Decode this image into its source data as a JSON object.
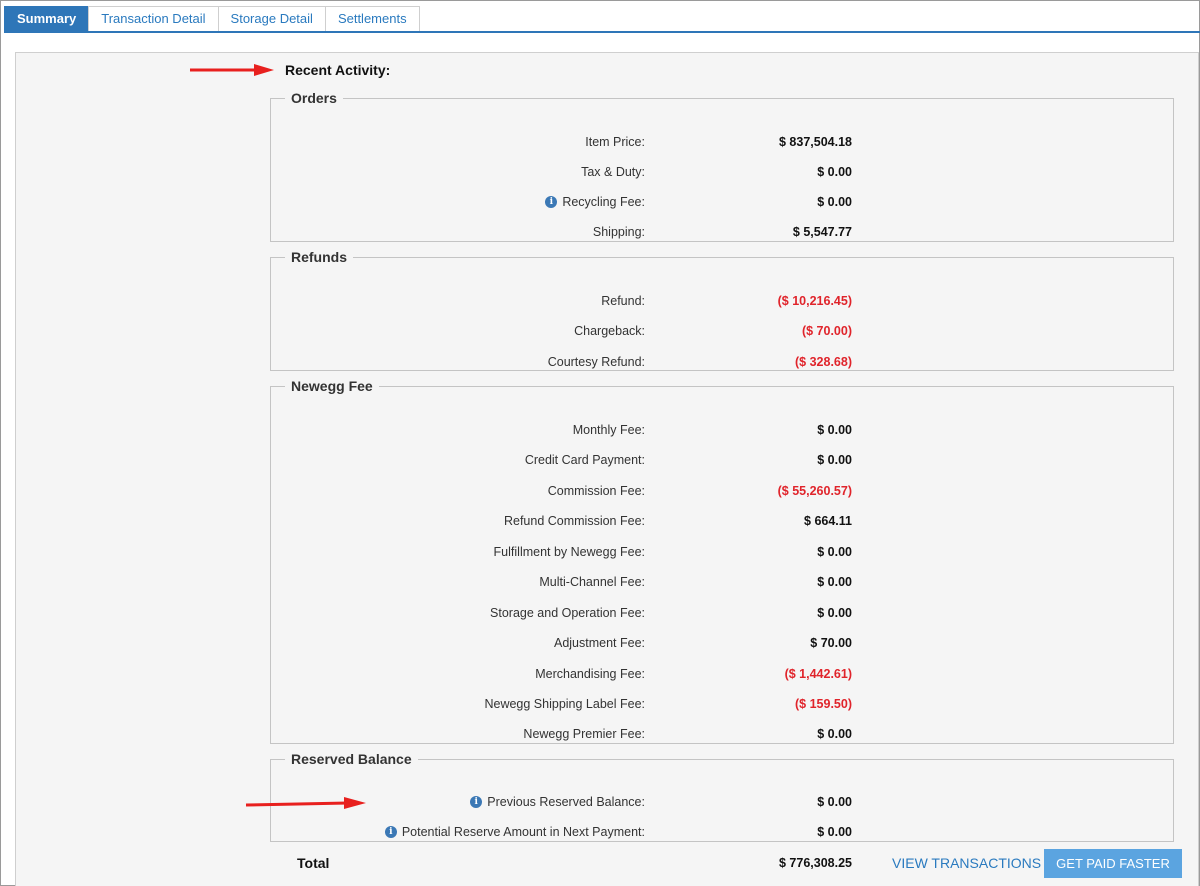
{
  "tabs": [
    {
      "label": "Summary",
      "active": true
    },
    {
      "label": "Transaction Detail",
      "active": false
    },
    {
      "label": "Storage Detail",
      "active": false
    },
    {
      "label": "Settlements",
      "active": false
    }
  ],
  "heading": "Recent Activity:",
  "groups": {
    "orders": {
      "title": "Orders",
      "rows": [
        {
          "label": "Item Price:",
          "value": "$ 837,504.18"
        },
        {
          "label": "Tax & Duty:",
          "value": "$ 0.00"
        },
        {
          "label": "Recycling Fee:",
          "value": "$ 0.00",
          "info": true
        },
        {
          "label": "Shipping:",
          "value": "$ 5,547.77"
        }
      ]
    },
    "refunds": {
      "title": "Refunds",
      "rows": [
        {
          "label": "Refund:",
          "value": "($ 10,216.45)",
          "negative": true
        },
        {
          "label": "Chargeback:",
          "value": "($ 70.00)",
          "negative": true
        },
        {
          "label": "Courtesy Refund:",
          "value": "($ 328.68)",
          "negative": true
        }
      ]
    },
    "newegg_fee": {
      "title": "Newegg Fee",
      "rows": [
        {
          "label": "Monthly Fee:",
          "value": "$ 0.00"
        },
        {
          "label": "Credit Card Payment:",
          "value": "$ 0.00"
        },
        {
          "label": "Commission Fee:",
          "value": "($ 55,260.57)",
          "negative": true
        },
        {
          "label": "Refund Commission Fee:",
          "value": "$ 664.11"
        },
        {
          "label": "Fulfillment by Newegg Fee:",
          "value": "$ 0.00"
        },
        {
          "label": "Multi-Channel Fee:",
          "value": "$ 0.00"
        },
        {
          "label": "Storage and Operation Fee:",
          "value": "$ 0.00"
        },
        {
          "label": "Adjustment Fee:",
          "value": "$ 70.00"
        },
        {
          "label": "Merchandising Fee:",
          "value": "($ 1,442.61)",
          "negative": true
        },
        {
          "label": "Newegg Shipping Label Fee:",
          "value": "($ 159.50)",
          "negative": true
        },
        {
          "label": "Newegg Premier Fee:",
          "value": "$ 0.00"
        }
      ]
    },
    "reserved_balance": {
      "title": "Reserved Balance",
      "rows": [
        {
          "label": "Previous Reserved Balance:",
          "value": "$ 0.00",
          "info": true
        },
        {
          "label": "Potential Reserve Amount in Next Payment:",
          "value": "$ 0.00",
          "info": true
        }
      ]
    }
  },
  "total": {
    "label": "Total",
    "value": "$ 776,308.25"
  },
  "actions": {
    "view_transactions": "VIEW TRANSACTIONS",
    "get_paid_faster": "GET PAID FASTER"
  },
  "icons": {
    "info": "info-icon",
    "annotation": "red-arrow-icon"
  },
  "colors": {
    "accent": "#2e76b8",
    "negative": "#e0242b",
    "button": "#5ba4e0",
    "annotation": "#e8201e"
  }
}
